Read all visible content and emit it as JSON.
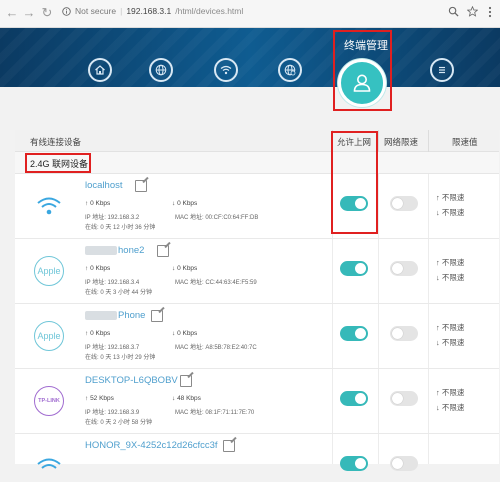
{
  "browser": {
    "back_icon": "back-arrow-icon",
    "forward_icon": "forward-arrow-icon",
    "reload_icon": "reload-icon",
    "secure_label": "Not secure",
    "url_host": "192.168.3.1",
    "url_path": "/html/devices.html"
  },
  "header": {
    "active_nav_label": "终端管理",
    "nav_icons": [
      "home-icon",
      "globe-icon",
      "wifi-icon",
      "globe-settings-icon",
      "terminal-icon",
      "menu-icon"
    ]
  },
  "table": {
    "columns": {
      "device": "有线连接设备",
      "allow": "允许上网",
      "speedup": "网络限速",
      "limit": "限速值"
    },
    "band_label": "2.4G 联网设备"
  },
  "devices": [
    {
      "icon": "wifi-icon",
      "name_prefix_blurred": false,
      "name": "localhost",
      "up": "0 Kbps",
      "down": "0 Kbps",
      "ip": "IP 地址: 192.168.3.2",
      "mac": "MAC 地址: 00:CF:C0:64:FF:DB",
      "online": "在线: 0 天 12 小时 36 分钟",
      "allow_internet": true,
      "speed_limit": false,
      "limit_up": "不限速",
      "limit_down": "不限速"
    },
    {
      "icon": "Apple",
      "name_prefix_blurred": true,
      "name": "hone2",
      "up": "0 Kbps",
      "down": "0 Kbps",
      "ip": "IP 地址: 192.168.3.4",
      "mac": "MAC 地址: CC:44:63:4E:F5:59",
      "online": "在线: 0 天 3 小时 44 分钟",
      "allow_internet": true,
      "speed_limit": false,
      "limit_up": "不限速",
      "limit_down": "不限速"
    },
    {
      "icon": "Apple",
      "name_prefix_blurred": true,
      "name": "Phone",
      "up": "0 Kbps",
      "down": "0 Kbps",
      "ip": "IP 地址: 192.168.3.7",
      "mac": "MAC 地址: A8:5B:78:E2:40:7C",
      "online": "在线: 0 天 13 小时 29 分钟",
      "allow_internet": true,
      "speed_limit": false,
      "limit_up": "不限速",
      "limit_down": "不限速"
    },
    {
      "icon": "TP-LINK",
      "name_prefix_blurred": false,
      "name": "DESKTOP-L6QBOBV",
      "up": "52 Kbps",
      "down": "48 Kbps",
      "ip": "IP 地址: 192.168.3.9",
      "mac": "MAC 地址: 08:1F:71:11:7E:70",
      "online": "在线: 0 天 2 小时 58 分钟",
      "allow_internet": true,
      "speed_limit": false,
      "limit_up": "不限速",
      "limit_down": "不限速"
    },
    {
      "icon": "wifi-icon",
      "name_prefix_blurred": false,
      "name": "HONOR_9X-4252c12d26cfcc3f",
      "allow_internet": true,
      "speed_limit": false
    }
  ],
  "colors": {
    "accent": "#36b9b9",
    "link": "#4f9fcd",
    "highlight": "#e02020",
    "header": "#0f5c91"
  }
}
